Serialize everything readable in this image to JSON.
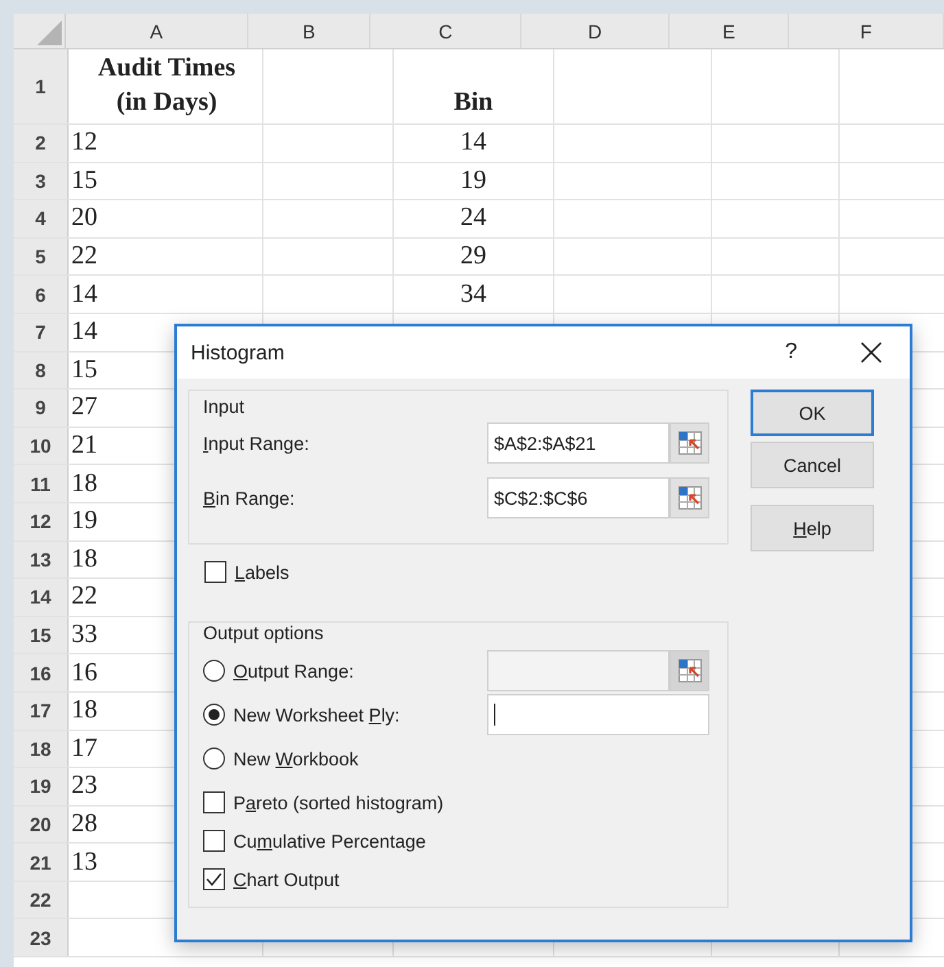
{
  "spreadsheet": {
    "columns": [
      "A",
      "B",
      "C",
      "D",
      "E",
      "F"
    ],
    "rows": [
      {
        "number": "1",
        "kind": "header",
        "a": "Audit Times (in Days)",
        "c": "Bin"
      },
      {
        "number": "2",
        "a": "12",
        "c": "14"
      },
      {
        "number": "3",
        "a": "15",
        "c": "19"
      },
      {
        "number": "4",
        "a": "20",
        "c": "24"
      },
      {
        "number": "5",
        "a": "22",
        "c": "29"
      },
      {
        "number": "6",
        "a": "14",
        "c": "34"
      },
      {
        "number": "7",
        "a": "14"
      },
      {
        "number": "8",
        "a": "15"
      },
      {
        "number": "9",
        "a": "27"
      },
      {
        "number": "10",
        "a": "21"
      },
      {
        "number": "11",
        "a": "18"
      },
      {
        "number": "12",
        "a": "19"
      },
      {
        "number": "13",
        "a": "18"
      },
      {
        "number": "14",
        "a": "22"
      },
      {
        "number": "15",
        "a": "33"
      },
      {
        "number": "16",
        "a": "16"
      },
      {
        "number": "17",
        "a": "18"
      },
      {
        "number": "18",
        "a": "17"
      },
      {
        "number": "19",
        "a": "23"
      },
      {
        "number": "20",
        "a": "28"
      },
      {
        "number": "21",
        "a": "13"
      },
      {
        "number": "22"
      },
      {
        "number": "23"
      }
    ]
  },
  "dialog": {
    "title": "Histogram",
    "help": "?",
    "input_group": {
      "title": "Input",
      "fields": [
        {
          "label": {
            "key": "I",
            "after": "nput Range:"
          },
          "value": "$A$2:$A$21"
        },
        {
          "label": {
            "key": "B",
            "after": "in Range:"
          },
          "value": "$C$2:$C$6"
        }
      ]
    },
    "labels_checkbox": {
      "label": {
        "key": "L",
        "after": "abels"
      },
      "checked": false
    },
    "output_group": {
      "title": "Output options",
      "options": [
        {
          "label": {
            "key": "O",
            "after": "utput Range:"
          },
          "selected": false,
          "kind": "range"
        },
        {
          "label": {
            "before": "New Worksheet ",
            "key": "P",
            "after": "ly:"
          },
          "selected": true,
          "kind": "text"
        },
        {
          "label": {
            "before": "New ",
            "key": "W",
            "after": "orkbook"
          },
          "selected": false
        }
      ],
      "checkboxes": [
        {
          "label": {
            "before": "P",
            "key": "a",
            "after": "reto (sorted histogram)"
          },
          "checked": false
        },
        {
          "label": {
            "before": "Cu",
            "key": "m",
            "after": "ulative Percentage"
          },
          "checked": false
        },
        {
          "label": {
            "key": "C",
            "after": "hart Output"
          },
          "checked": true
        }
      ]
    },
    "buttons": [
      {
        "label": {
          "before": "OK"
        },
        "default": true
      },
      {
        "label": {
          "before": "Cancel"
        },
        "default": false
      },
      {
        "label": {
          "key": "H",
          "after": "elp"
        },
        "default": false
      }
    ]
  }
}
